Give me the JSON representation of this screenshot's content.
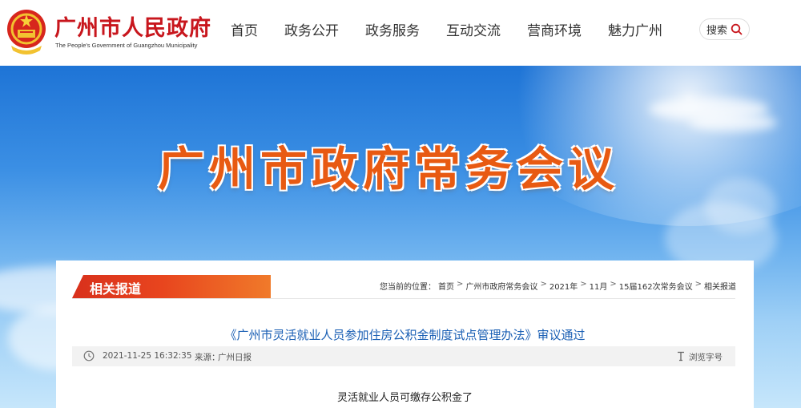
{
  "header": {
    "site_title": "广州市人民政府",
    "site_subtitle": "The People's Government of Guangzhou Municipality",
    "nav": [
      "首页",
      "政务公开",
      "政务服务",
      "互动交流",
      "营商环境",
      "魅力广州"
    ],
    "search_label": "搜索"
  },
  "banner": {
    "title": "广州市政府常务会议"
  },
  "section": {
    "tab_label": "相关报道"
  },
  "breadcrumb": {
    "prefix": "您当前的位置：",
    "items": [
      "首页",
      "广州市政府常务会议",
      "2021年",
      "11月",
      "15届162次常务会议",
      "相关报道"
    ],
    "separator": ">"
  },
  "article": {
    "title": "《广州市灵活就业人员参加住房公积金制度试点管理办法》审议通过",
    "date": "2021-11-25 16:32:35",
    "source_label": "来源：",
    "source": "广州日报",
    "font_size_label": "浏览字号",
    "lead": "灵活就业人员可缴存公积金了"
  },
  "colors": {
    "brand_red": "#c8161d",
    "tab_orange": "#e8451e",
    "link_blue": "#1a5fb4"
  }
}
